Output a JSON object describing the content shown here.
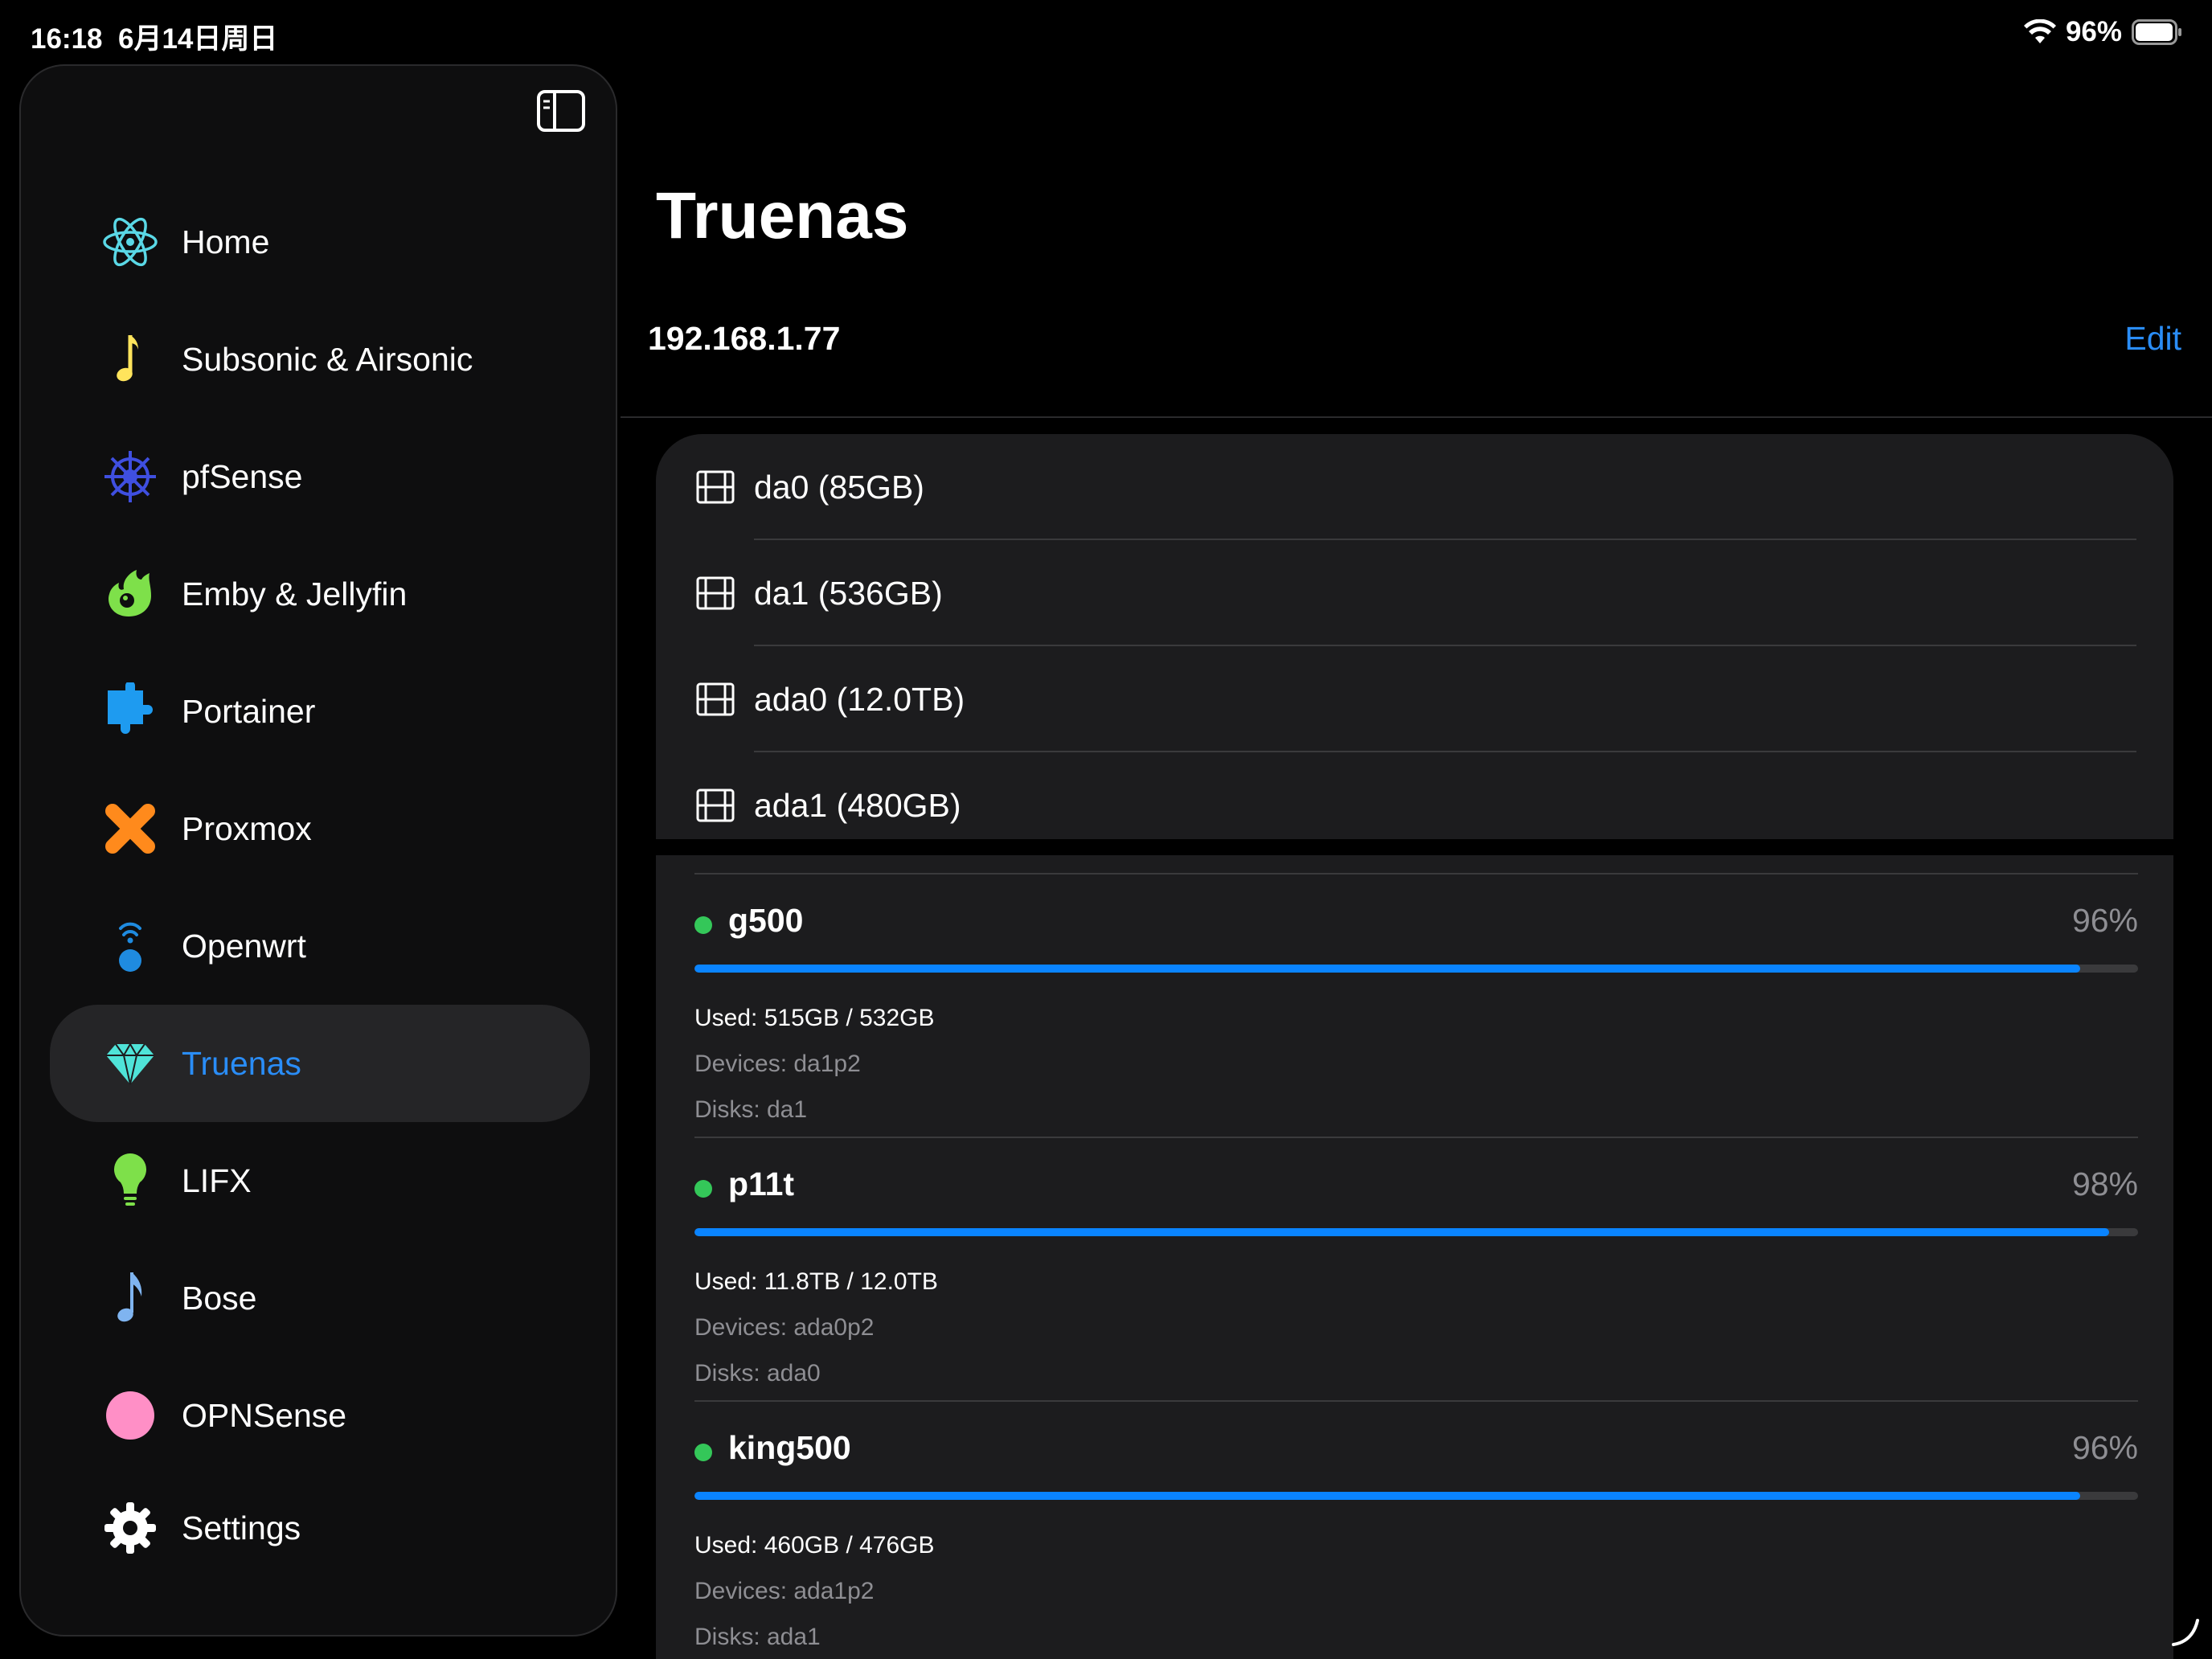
{
  "status_bar": {
    "time": "16:18",
    "date": "6月14日周日",
    "battery": "96%"
  },
  "sidebar": {
    "items": [
      {
        "label": "Home",
        "icon": "atom-icon",
        "active": false
      },
      {
        "label": "Subsonic & Airsonic",
        "icon": "music-note-icon",
        "active": false
      },
      {
        "label": "pfSense",
        "icon": "ship-wheel-icon",
        "active": false
      },
      {
        "label": "Emby & Jellyfin",
        "icon": "emby-logo-icon",
        "active": false
      },
      {
        "label": "Portainer",
        "icon": "puzzle-piece-icon",
        "active": false
      },
      {
        "label": "Proxmox",
        "icon": "proxmox-x-icon",
        "active": false
      },
      {
        "label": "Openwrt",
        "icon": "wireless-antenna-icon",
        "active": false
      },
      {
        "label": "Truenas",
        "icon": "diamond-icon",
        "active": true
      },
      {
        "label": "LIFX",
        "icon": "light-bulb-icon",
        "active": false
      },
      {
        "label": "Bose",
        "icon": "music-note-icon",
        "active": false
      },
      {
        "label": "OPNSense",
        "icon": "pink-circle-icon",
        "active": false
      },
      {
        "label": "Settings",
        "icon": "gear-icon",
        "active": false
      }
    ]
  },
  "main": {
    "title": "Truenas",
    "host": "192.168.1.77",
    "edit_label": "Edit",
    "disks": [
      {
        "label": "da0 (85GB)"
      },
      {
        "label": "da1 (536GB)"
      },
      {
        "label": "ada0 (12.0TB)"
      },
      {
        "label": "ada1 (480GB)"
      }
    ],
    "pools": [
      {
        "name": "g500",
        "percent": "96%",
        "fraction": 0.96,
        "used": "Used: 515GB / 532GB",
        "devices": "Devices: da1p2",
        "disks": "Disks: da1"
      },
      {
        "name": "p11t",
        "percent": "98%",
        "fraction": 0.98,
        "used": "Used: 11.8TB / 12.0TB",
        "devices": "Devices: ada0p2",
        "disks": "Disks: ada0"
      },
      {
        "name": "king500",
        "percent": "96%",
        "fraction": 0.96,
        "used": "Used: 460GB / 476GB",
        "devices": "Devices: ada1p2",
        "disks": "Disks: ada1"
      }
    ]
  },
  "colors": {
    "accent": "#2a8df7",
    "progress": "#0a84ff",
    "online": "#34c759"
  }
}
